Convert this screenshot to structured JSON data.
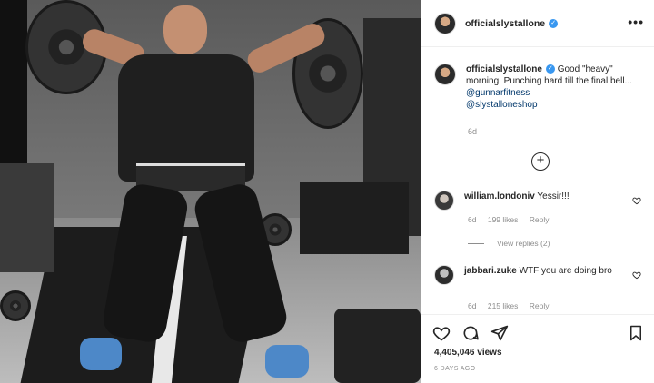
{
  "post": {
    "username": "officialslystallone",
    "verified_mark": "✓",
    "more_label": "•••"
  },
  "caption": {
    "username": "officialslystallone",
    "text_1": " Good \"heavy\" morning! Punching hard till the final bell... ",
    "mention_1": "@gunnarfitness",
    "mention_2": "@slystalloneshop",
    "time": "6d"
  },
  "add_comment_icon": "+",
  "comments": [
    {
      "username": "william.londoniv",
      "text": " Yessir!!!",
      "time": "6d",
      "likes": "199 likes",
      "reply": "Reply",
      "view_replies": "View replies (2)"
    },
    {
      "username": "jabbari.zuke",
      "text": " WTF you are doing bro",
      "time": "6d",
      "likes": "215 likes",
      "reply": "Reply"
    }
  ],
  "actions": {
    "views": "4,405,046 views",
    "posted_ago": "6 DAYS AGO"
  },
  "colors": {
    "link": "#00376b",
    "verified": "#3897f0",
    "muted": "#8e8e8e"
  },
  "icons": [
    "heart-icon",
    "comment-icon",
    "share-icon",
    "bookmark-icon",
    "plus-circle-icon",
    "more-icon",
    "verified-icon"
  ]
}
